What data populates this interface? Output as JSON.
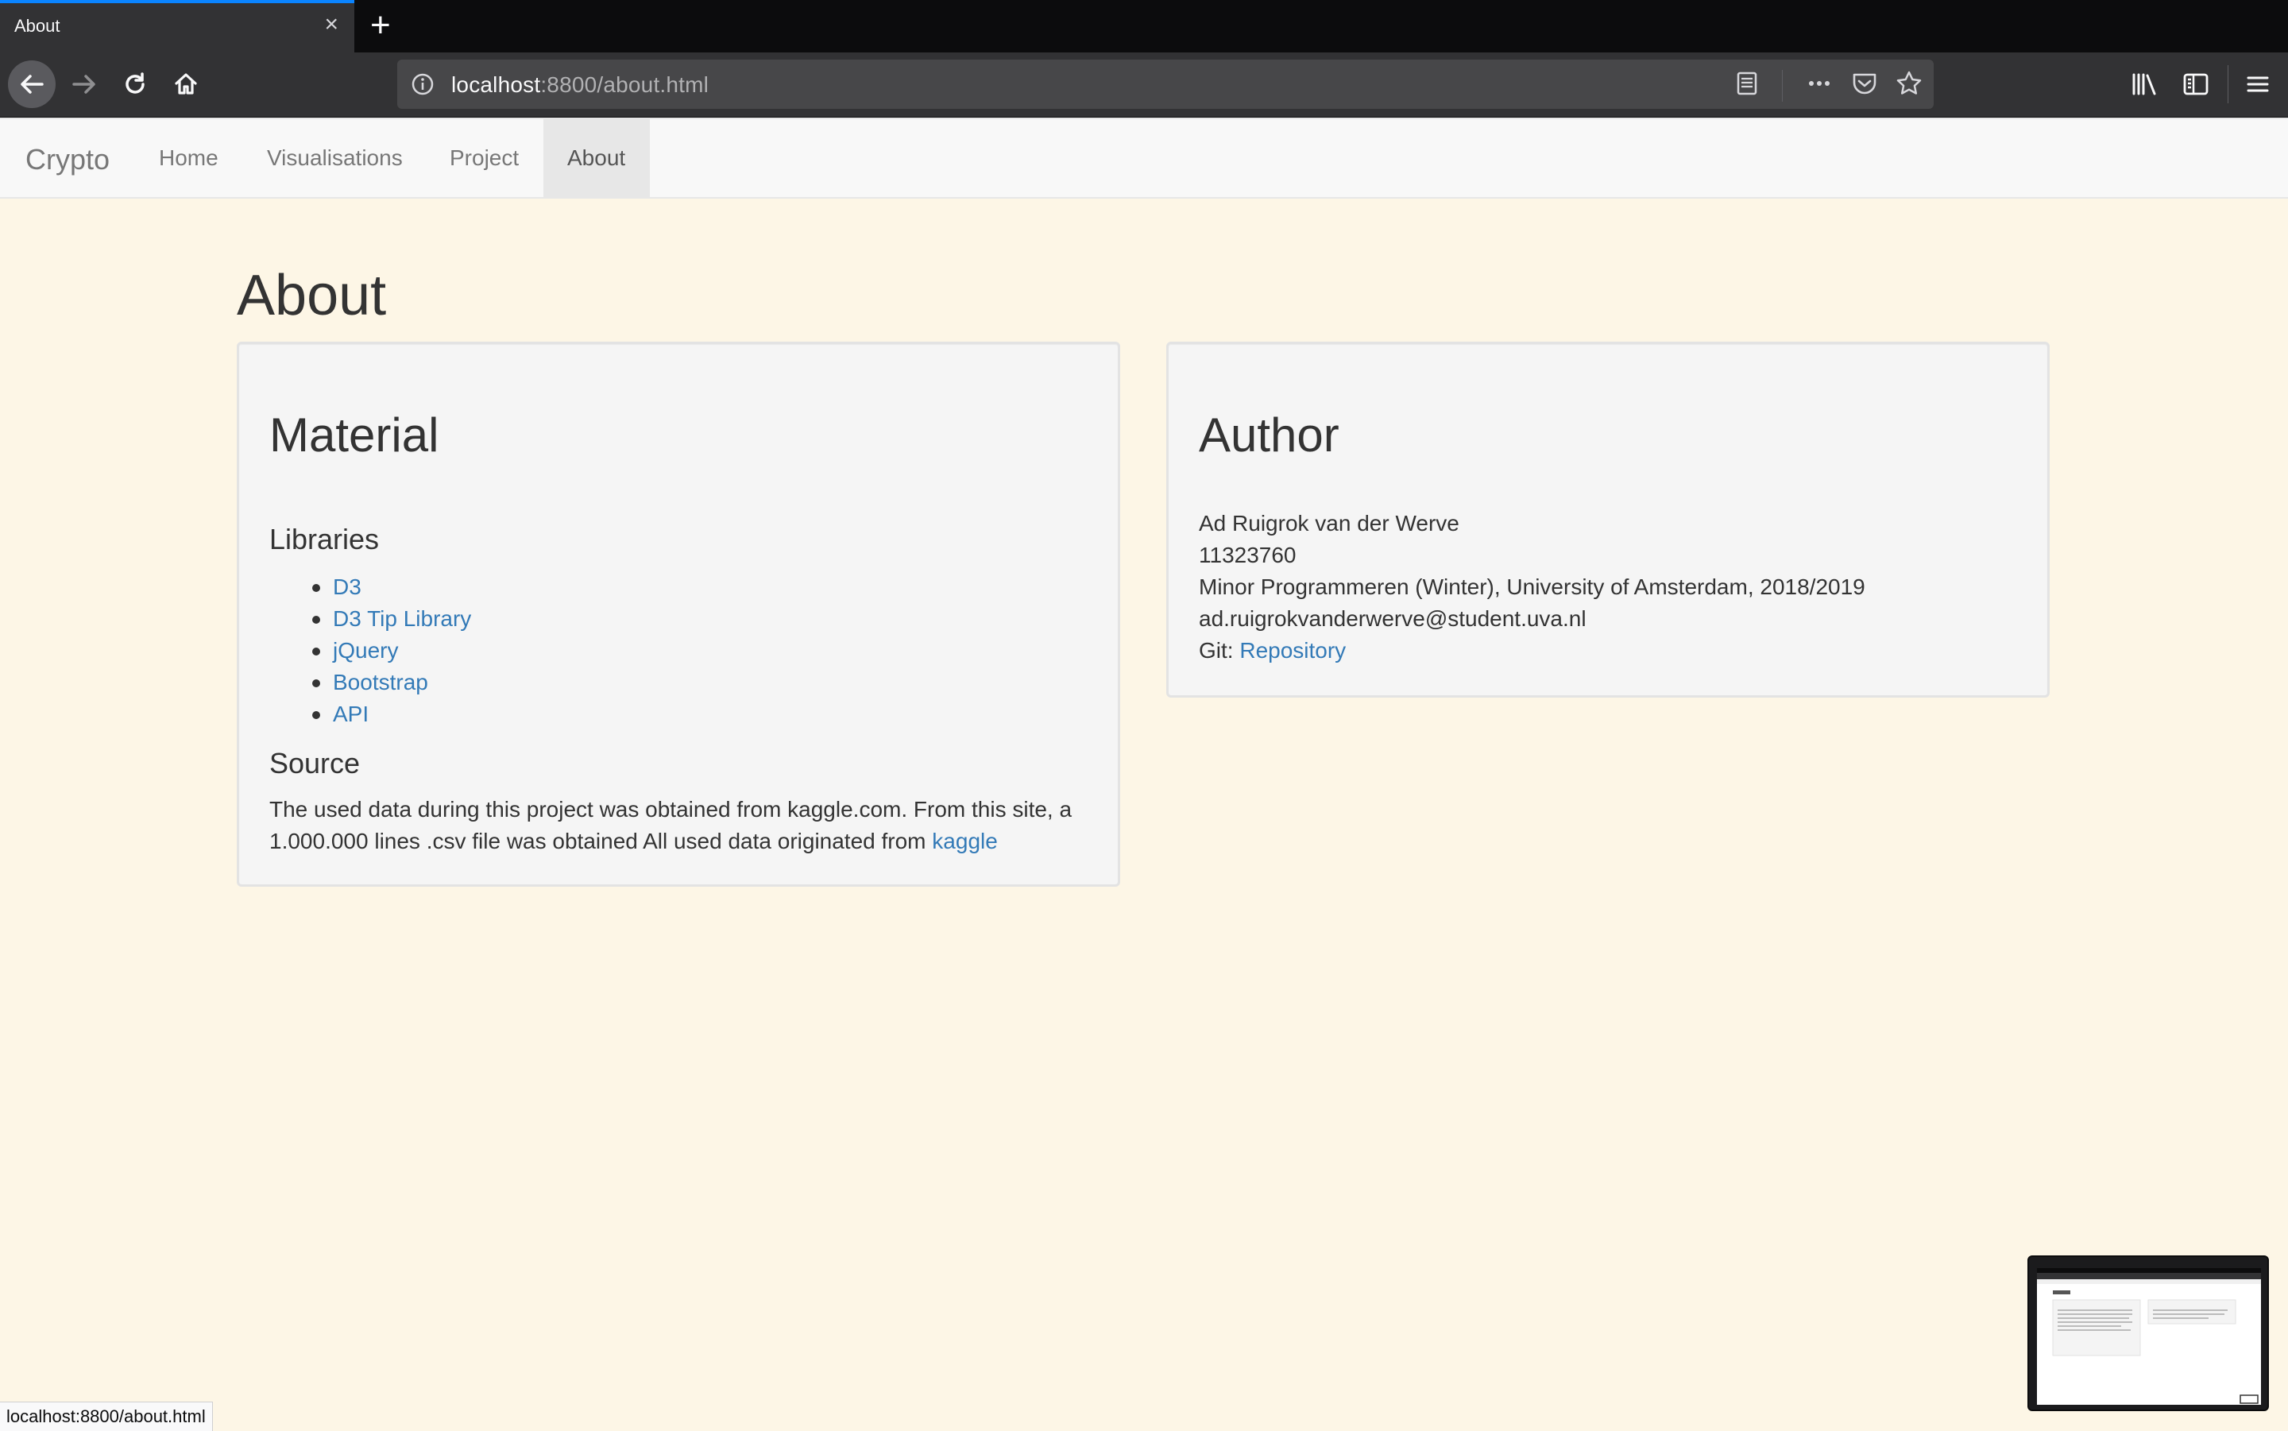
{
  "browser": {
    "tab_title": "About",
    "tab_close": "×",
    "new_tab": "+",
    "url_host": "localhost",
    "url_rest": ":8800/about.html",
    "icons": [
      "back-arrow-icon",
      "forward-arrow-icon",
      "reload-icon",
      "home-icon",
      "info-icon",
      "reader-view-icon",
      "more-icon",
      "pocket-icon",
      "star-icon",
      "library-icon",
      "sidebar-icon",
      "menu-icon"
    ],
    "accent": "#0a84ff"
  },
  "navbar": {
    "brand": "Crypto",
    "links": [
      {
        "label": "Home"
      },
      {
        "label": "Visualisations"
      },
      {
        "label": "Project"
      },
      {
        "label": "About",
        "active": true
      }
    ]
  },
  "page": {
    "title": "About",
    "material": {
      "heading": "Material",
      "libraries_heading": "Libraries",
      "libraries": [
        "D3",
        "D3 Tip Library",
        "jQuery",
        "Bootstrap",
        "API"
      ],
      "source_heading": "Source",
      "source_line1": "The used data during this project was obtained from kaggle.com. From this site, a",
      "source_line2": "1.000.000 lines .csv file was obtained All used data originated from ",
      "source_link": "kaggle"
    },
    "author": {
      "heading": "Author",
      "name": "Ad Ruigrok van der Werve",
      "student_number": "11323760",
      "program": "Minor Programmeren (Winter), University of Amsterdam, 2018/2019",
      "email": "ad.ruigrokvanderwerve@student.uva.nl",
      "git_label": "Git: ",
      "git_link": "Repository"
    },
    "link_color": "#337ab7",
    "background": "#fdf6e6"
  },
  "status_bar": {
    "text": "localhost:8800/about.html"
  }
}
